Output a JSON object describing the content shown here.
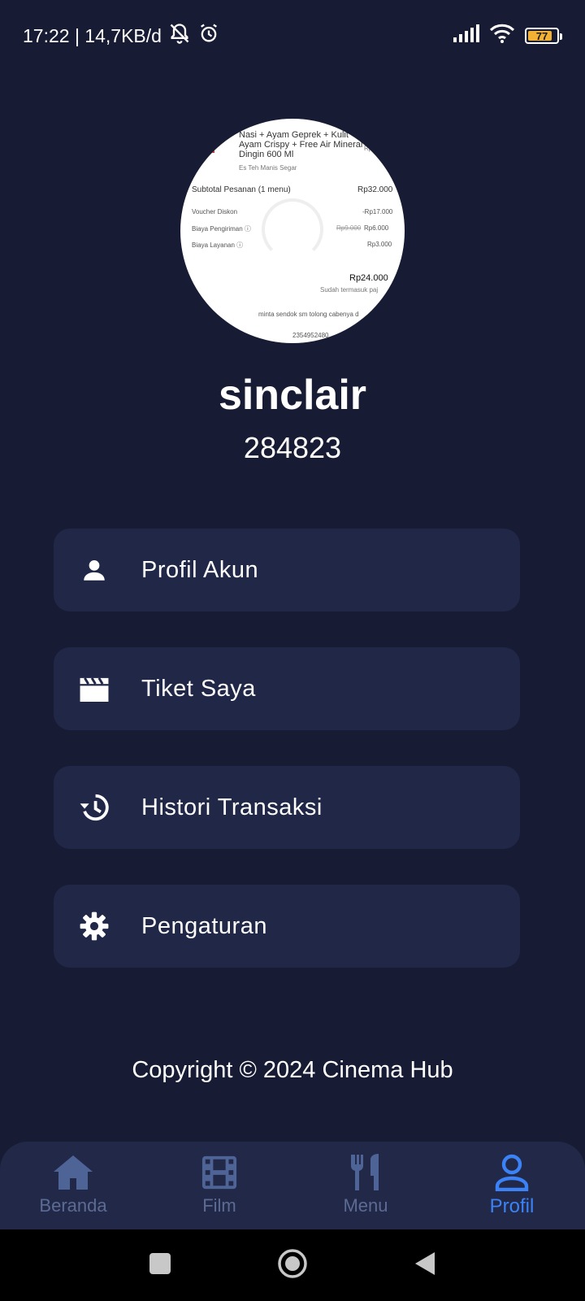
{
  "status_bar": {
    "time_speed": "17:22 | 14,7KB/d",
    "battery_level": "77",
    "icons": [
      "notifications-off-icon",
      "alarm-icon",
      "signal-icon",
      "wifi-icon",
      "battery-icon"
    ]
  },
  "profile": {
    "avatar_receipt": {
      "item_name_1": "Nasi + Ayam Geprek + Kulit",
      "item_name_2": "Ayam Crispy + Free Air Mineral",
      "item_name_3": "Dingin 600 Ml",
      "item_price": "Rp",
      "item_extra": "Es Teh Manis Segar",
      "subtotal_label": "Subtotal Pesanan (1 menu)",
      "subtotal_value": "Rp32.000",
      "voucher_label": "Voucher Diskon",
      "voucher_value": "-Rp17.000",
      "delivery_label": "Biaya Pengiriman ⓘ",
      "delivery_old": "Rp9.000",
      "delivery_value": "Rp6.000",
      "service_label": "Biaya Layanan ⓘ",
      "service_value": "Rp3.000",
      "total_value": "Rp24.000",
      "tax_note": "Sudah termasuk paj",
      "note": "minta sendok sm tolong cabenya d",
      "order_id": "2354952480"
    },
    "username": "sinclair",
    "user_id": "284823"
  },
  "menu": {
    "items": [
      {
        "label": "Profil Akun",
        "icon": "person-icon"
      },
      {
        "label": "Tiket Saya",
        "icon": "clapperboard-icon"
      },
      {
        "label": "Histori Transaksi",
        "icon": "history-icon"
      },
      {
        "label": "Pengaturan",
        "icon": "gear-icon"
      }
    ]
  },
  "footer": {
    "copyright": "Copyright © 2024 Cinema Hub"
  },
  "bottom_nav": {
    "items": [
      {
        "label": "Beranda",
        "icon": "home-icon"
      },
      {
        "label": "Film",
        "icon": "film-icon"
      },
      {
        "label": "Menu",
        "icon": "utensils-icon"
      },
      {
        "label": "Profil",
        "icon": "profile-icon"
      }
    ],
    "active": "Profil",
    "active_color": "#3b82f6",
    "inactive_color": "#5c6b94"
  },
  "colors": {
    "background": "#171b33",
    "card": "#202747",
    "nav_background": "#222948"
  }
}
